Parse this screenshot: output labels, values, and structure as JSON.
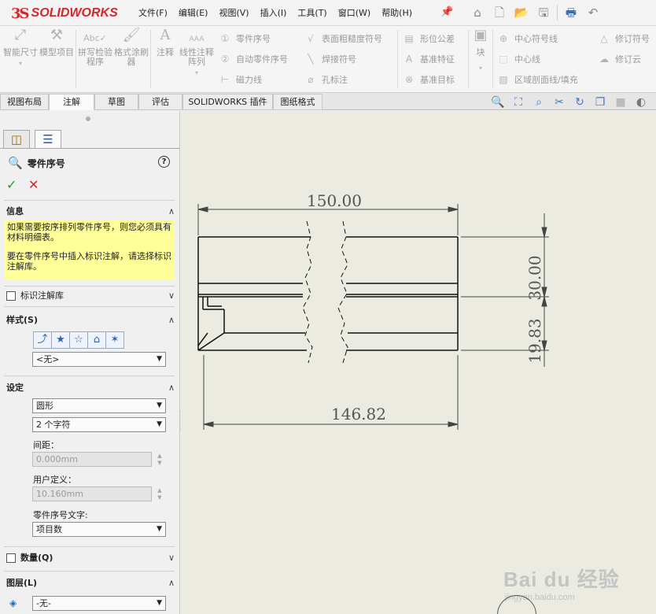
{
  "app": {
    "brand": "SOLIDWORKS",
    "brand_prefix": "3S"
  },
  "menu": [
    "文件(F)",
    "编辑(E)",
    "视图(V)",
    "插入(I)",
    "工具(T)",
    "窗口(W)",
    "帮助(H)"
  ],
  "quick_access": [
    "home-icon",
    "new-file-icon",
    "open-folder-icon",
    "save-icon",
    "print-icon",
    "undo-icon"
  ],
  "command_manager": {
    "big_tools": [
      {
        "icon": "smart-dimension-icon",
        "label": "智能尺寸"
      },
      {
        "icon": "model-items-icon",
        "label": "模型项目"
      },
      {
        "icon": "spell-check-icon",
        "label": "拼写检验程序"
      },
      {
        "icon": "format-painter-icon",
        "label": "格式涂刷器"
      },
      {
        "icon": "note-icon",
        "label": "注释"
      },
      {
        "icon": "linear-note-pattern-icon",
        "label": "线性注释阵列"
      }
    ],
    "small_tools_col1": [
      "零件序号",
      "自动零件序号",
      "磁力线"
    ],
    "small_tools_col2": [
      "表面粗糙度符号",
      "焊接符号",
      "孔标注"
    ],
    "small_tools_col3": [
      "形位公差",
      "基准特征",
      "基准目标"
    ],
    "block_tool": "块",
    "small_tools_col4": [
      "中心符号线",
      "中心线",
      "区域剖面线/填充"
    ],
    "small_tools_col5": [
      "修订符号",
      "修订云"
    ]
  },
  "tabs": [
    "视图布局",
    "注解",
    "草图",
    "评估",
    "SOLIDWORKS 插件",
    "图纸格式"
  ],
  "active_tab": "注解",
  "property_manager": {
    "title": "零件序号",
    "help": "?",
    "ok": "✓",
    "cancel": "✕",
    "info": {
      "header": "信息",
      "line1": "如果需要按序排列零件序号，则您必须具有材料明细表。",
      "line2": "要在零件序号中插入标识注解，请选择标识注解库。"
    },
    "annotation_library": "标识注解库",
    "style": {
      "header": "样式(S)",
      "value": "<无>"
    },
    "settings": {
      "header": "设定",
      "shape": "圆形",
      "size": "2 个字符",
      "spacing_label": "间距：",
      "spacing_value": "0.000mm",
      "user_label": "用户定义：",
      "user_value": "10.160mm",
      "text_label": "零件序号文字:",
      "text_value": "项目数"
    },
    "quantity": "数量(Q)",
    "layer": {
      "header": "图层(L)",
      "value": "-无-"
    }
  },
  "drawing": {
    "dim_top": "150.00",
    "dim_bottom": "146.82",
    "dim_right_outer": "30.00",
    "dim_right_inner": "19.83"
  },
  "watermark": {
    "main": "Bai du 经验",
    "sub": "jingyan.baidu.com"
  }
}
